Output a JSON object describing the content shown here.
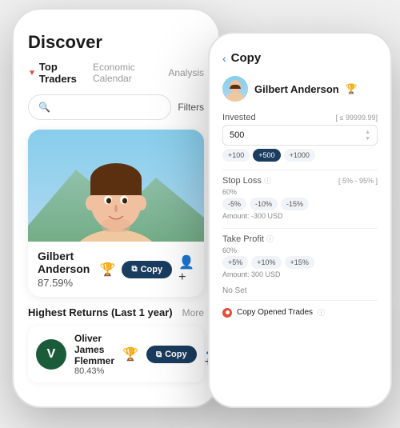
{
  "scene": {
    "background": "#f0f0f0"
  },
  "phone_left": {
    "title": "Discover",
    "tabs": [
      {
        "label": "Top Traders",
        "active": true
      },
      {
        "label": "Economic Calendar",
        "active": false
      },
      {
        "label": "Analysis",
        "active": false
      }
    ],
    "search": {
      "placeholder": "Search"
    },
    "filters_label": "Filters",
    "featured_trader": {
      "name": "Gilbert Anderson",
      "return_pct": "87.59%",
      "copy_label": "Copy"
    },
    "section_title": "Highest Returns (Last 1 year)",
    "more_label": "More",
    "mini_traders": [
      {
        "avatar_letter": "V",
        "name": "Oliver James Flemmer",
        "return_pct": "80.43%",
        "copy_label": "Copy"
      }
    ]
  },
  "phone_right": {
    "back_label": "Copy",
    "trader_name": "Gilbert Anderson",
    "fields": [
      {
        "label": "Invested",
        "hint": "[ ≤ 99999.99]",
        "value": "500",
        "chips": [
          "+100",
          "+500",
          "+1000"
        ]
      },
      {
        "label": "Stop Loss",
        "hint": "[ 5% - 95% ]",
        "value_pct": "60%",
        "amount_label": "Amount: -300 USD",
        "chips": [
          "-5%",
          "-10%",
          "-15%"
        ]
      },
      {
        "label": "Take Profit",
        "hint": "",
        "value_pct": "60%",
        "amount_label": "Amount: 300 USD",
        "chips": [
          "+5%",
          "+10%",
          "+15%"
        ]
      }
    ],
    "no_set_label": "No Set",
    "copy_opened_trades_label": "Copy Opened Trades"
  }
}
